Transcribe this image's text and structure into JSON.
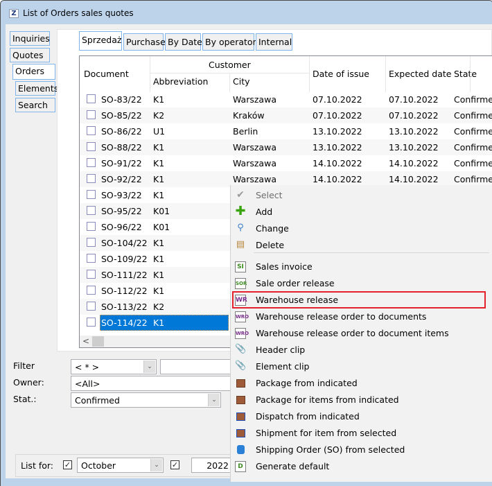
{
  "window": {
    "title": "List of Orders sales quotes",
    "app_icon": "Z"
  },
  "side_tabs": [
    {
      "label": "Inquiries",
      "active": false
    },
    {
      "label": "Quotes",
      "active": false
    },
    {
      "label": "Orders",
      "active": true
    },
    {
      "label": "Elements",
      "active": false
    },
    {
      "label": "Search",
      "active": false
    }
  ],
  "top_tabs": [
    {
      "label": "Sprzedaż",
      "active": true
    },
    {
      "label": "Purchase",
      "active": false
    },
    {
      "label": "By Date",
      "active": false
    },
    {
      "label": "By operator",
      "active": false
    },
    {
      "label": "Internal",
      "active": false
    }
  ],
  "grid": {
    "headers": {
      "document": "Document",
      "customer_group": "Customer",
      "abbreviation": "Abbreviation",
      "city": "City",
      "date_of_issue": "Date of issue",
      "expected_date": "Expected date",
      "state": "State"
    },
    "rows": [
      {
        "document": "SO-83/22",
        "abbreviation": "K1",
        "city": "Warszawa",
        "date_of_issue": "07.10.2022",
        "expected_date": "07.10.2022",
        "state": "Confirmed"
      },
      {
        "document": "SO-85/22",
        "abbreviation": "K2",
        "city": "Kraków",
        "date_of_issue": "07.10.2022",
        "expected_date": "07.10.2022",
        "state": "Confirmed"
      },
      {
        "document": "SO-86/22",
        "abbreviation": "U1",
        "city": "Berlin",
        "date_of_issue": "13.10.2022",
        "expected_date": "13.10.2022",
        "state": "Confirmed"
      },
      {
        "document": "SO-88/22",
        "abbreviation": "K1",
        "city": "Warszawa",
        "date_of_issue": "13.10.2022",
        "expected_date": "13.10.2022",
        "state": "Confirmed"
      },
      {
        "document": "SO-91/22",
        "abbreviation": "K1",
        "city": "Warszawa",
        "date_of_issue": "14.10.2022",
        "expected_date": "14.10.2022",
        "state": "Confirmed"
      },
      {
        "document": "SO-92/22",
        "abbreviation": "K1",
        "city": "Warszawa",
        "date_of_issue": "14.10.2022",
        "expected_date": "14.10.2022",
        "state": "Confirmed"
      },
      {
        "document": "SO-93/22",
        "abbreviation": "K1"
      },
      {
        "document": "SO-95/22",
        "abbreviation": "K01"
      },
      {
        "document": "SO-96/22",
        "abbreviation": "K01"
      },
      {
        "document": "SO-104/22",
        "abbreviation": "K1"
      },
      {
        "document": "SO-109/22",
        "abbreviation": "K1"
      },
      {
        "document": "SO-111/22",
        "abbreviation": "K1"
      },
      {
        "document": "SO-112/22",
        "abbreviation": "K1"
      },
      {
        "document": "SO-113/22",
        "abbreviation": "K2"
      },
      {
        "document": "SO-114/22",
        "abbreviation": "K1",
        "selected": true
      }
    ],
    "scroll_left_arrow": "<"
  },
  "filters": {
    "filter_label": "Filter",
    "filter_value": "< * >",
    "filter_text": "",
    "owner_label": "Owner:",
    "owner_value": "<All>",
    "status_label": "Stat.:",
    "status_value": "Confirmed"
  },
  "list_for": {
    "label": "List for:",
    "month_checked": true,
    "month_value": "October",
    "year_checked": true,
    "year_value": "2022"
  },
  "context_menu": {
    "items": [
      {
        "label": "Select",
        "icon": "check-icon",
        "disabled": true
      },
      {
        "label": "Add",
        "icon": "plus-icon"
      },
      {
        "label": "Change",
        "icon": "magnifier-icon"
      },
      {
        "label": "Delete",
        "icon": "trash-icon"
      },
      {
        "label": "Sales invoice",
        "icon": "si-icon",
        "badge": "SI"
      },
      {
        "label": "Sale order release",
        "icon": "sor-icon",
        "badge": "SOR"
      },
      {
        "label": "Warehouse release",
        "icon": "wr-icon",
        "badge": "WR",
        "highlighted": true
      },
      {
        "label": "Warehouse release order to documents",
        "icon": "wro-icon",
        "badge": "WRO"
      },
      {
        "label": "Warehouse release order to document items",
        "icon": "wro-icon",
        "badge": "WRO"
      },
      {
        "label": "Header clip",
        "icon": "paperclip-icon"
      },
      {
        "label": "Element clip",
        "icon": "paperclip-icon"
      },
      {
        "label": "Package from indicated",
        "icon": "package-icon"
      },
      {
        "label": "Package for items from indicated",
        "icon": "package-icon"
      },
      {
        "label": "Dispatch from indicated",
        "icon": "dispatch-icon"
      },
      {
        "label": "Shipment for item from selected",
        "icon": "dispatch-icon"
      },
      {
        "label": "Shipping Order (SO) from selected",
        "icon": "shipping-order-icon"
      },
      {
        "label": "Generate default",
        "icon": "generate-default-icon",
        "badge": "D"
      }
    ]
  },
  "colors": {
    "selection": "#0078d7",
    "tab_border": "#7eb4ea",
    "highlight_box": "#e5202d",
    "title_bar": "#bcd3ea"
  }
}
